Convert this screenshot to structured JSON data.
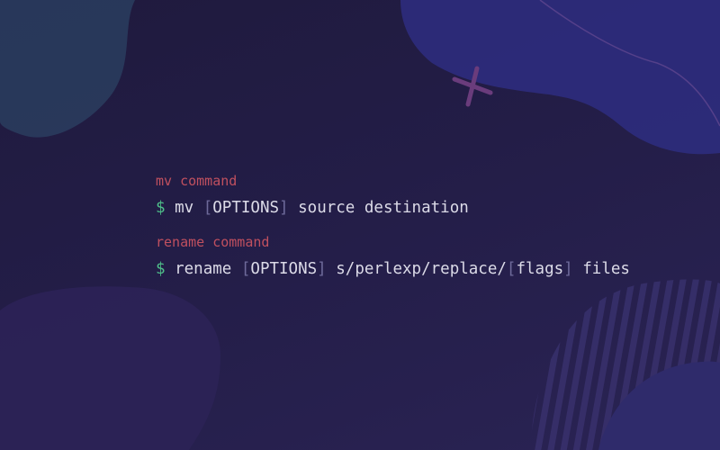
{
  "colors": {
    "background": "#231c45",
    "comment": "#c0505f",
    "prompt": "#4fbf8a",
    "text": "#dcdbe8",
    "bracket": "#6e6a9a"
  },
  "blocks": [
    {
      "comment": "mv command",
      "prompt": "$",
      "command": "mv",
      "options_open": "[",
      "options": "OPTIONS",
      "options_close": "]",
      "args": "source destination"
    },
    {
      "comment": "rename command",
      "prompt": "$",
      "command": "rename",
      "options_open": "[",
      "options": "OPTIONS",
      "options_close": "]",
      "expr": "s/perlexp/replace/",
      "flags_open": "[",
      "flags": "flags",
      "flags_close": "]",
      "args": "files"
    }
  ]
}
